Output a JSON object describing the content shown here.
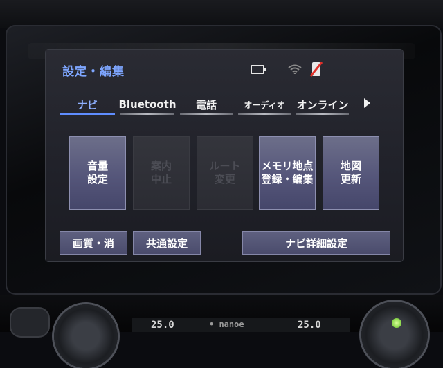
{
  "header": {
    "title": "設定・編集",
    "status_icons": [
      "battery-icon",
      "wifi-icon",
      "phone-off-icon"
    ]
  },
  "tabs": [
    {
      "label": "ナビ",
      "active": true
    },
    {
      "label": "Bluetooth",
      "active": false
    },
    {
      "label": "電話",
      "active": false
    },
    {
      "label": "オーディオ",
      "active": false
    },
    {
      "label": "オンライン",
      "active": false
    }
  ],
  "buttons": {
    "volume": "音量\n設定",
    "guidance_stop": "案内\n中止",
    "route_change": "ルート\n変更",
    "memory_points": "メモリ地点\n登録・編集",
    "map_update": "地図\n更新",
    "screen_off": "画質・消",
    "common_settings": "共通設定",
    "navi_detail": "ナビ詳細設定"
  },
  "climate": {
    "left_temp": "25.0",
    "right_temp": "25.0",
    "mode_text": "• nanoe"
  },
  "colors": {
    "accent": "#7ea6ff",
    "button_active": "#55567a",
    "button_disabled": "#2b2c33",
    "tab_active_underline": "#5f8dff"
  }
}
